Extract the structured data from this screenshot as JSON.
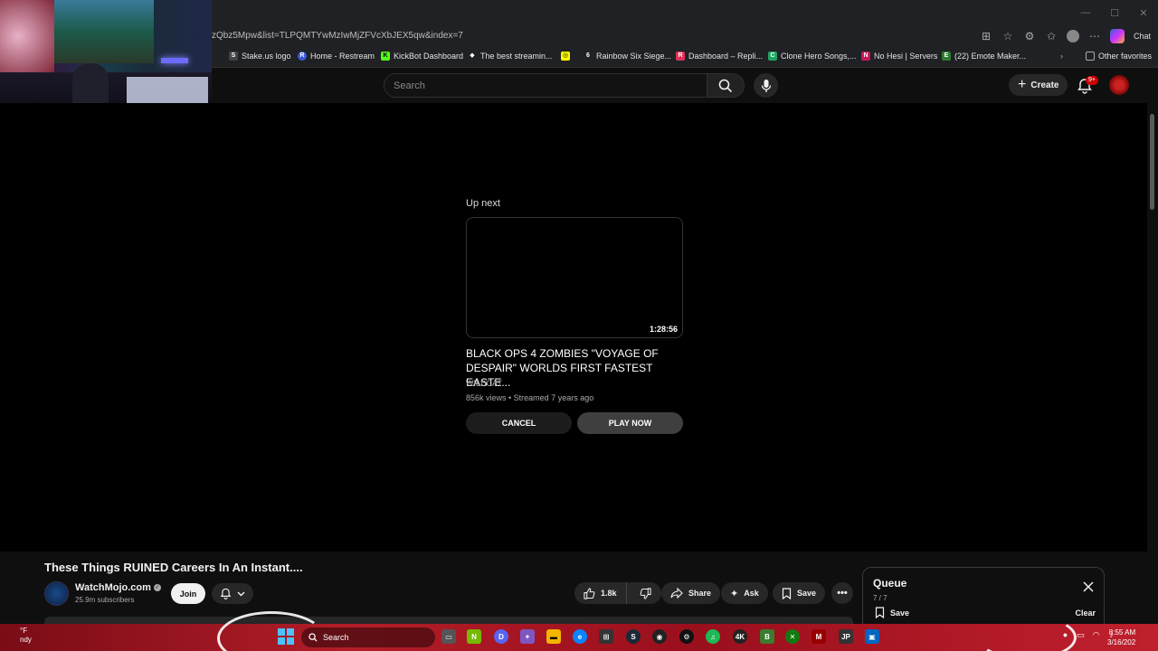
{
  "browser": {
    "url": "zQbz5Mpw&list=TLPQMTYwMzIwMjZFVcXbJEX5qw&index=7",
    "chat_label": "Chat",
    "bookmarks": [
      {
        "label": "Stake.us logo",
        "icon": "S"
      },
      {
        "label": "Home - Restream",
        "icon": "R"
      },
      {
        "label": "KickBot Dashboard",
        "icon": "K"
      },
      {
        "label": "The best streamin...",
        "icon": "◆"
      },
      {
        "label": "",
        "icon": "◎"
      },
      {
        "label": "Rainbow Six Siege...",
        "icon": "6"
      },
      {
        "label": "Dashboard – Repli...",
        "icon": "R"
      },
      {
        "label": "Clone Hero Songs,...",
        "icon": "C"
      },
      {
        "label": "No Hesi | Servers",
        "icon": "N"
      },
      {
        "label": "(22) Emote Maker...",
        "icon": "E"
      }
    ],
    "other_favorites": "Other favorites"
  },
  "header": {
    "search_placeholder": "Search",
    "create_label": "Create",
    "notification_badge": "9+"
  },
  "up_next": {
    "label": "Up next",
    "duration": "1:28:56",
    "title": "BLACK OPS 4 ZOMBIES \"VOYAGE OF DESPAIR\" WORLDS FIRST FASTEST EASTE...",
    "channel": "WILDCAT",
    "meta": "856k views • Streamed 7 years ago",
    "cancel_label": "CANCEL",
    "play_label": "PLAY NOW"
  },
  "video": {
    "title": "These Things RUINED Careers In An Instant....",
    "channel": "WatchMojo.com",
    "subscribers": "25.9m subscribers",
    "join_label": "Join",
    "likes": "1.8k",
    "share_label": "Share",
    "ask_label": "Ask",
    "save_label": "Save",
    "more_label": "•••"
  },
  "queue": {
    "title": "Queue",
    "count": "7 / 7",
    "save_label": "Save",
    "clear_label": "Clear"
  },
  "taskbar": {
    "weather_temp": "°F",
    "weather_desc": "ndy",
    "search_label": "Search",
    "time": "8:55 AM",
    "date": "3/16/202"
  },
  "colors": {
    "taskbar_accent": "#b21d28",
    "badge_red": "#cc0000",
    "start_blue": "#4cc2ff"
  }
}
